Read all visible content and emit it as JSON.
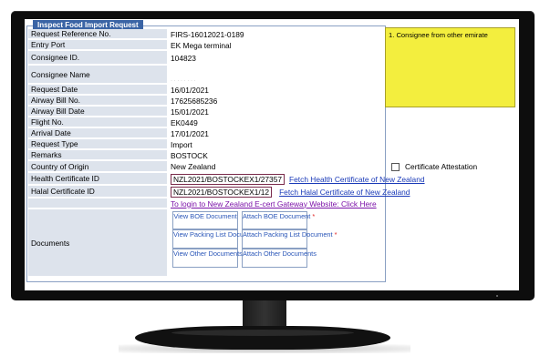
{
  "form": {
    "legend": "Inspect Food Import Request",
    "rows": [
      {
        "label": "Request Reference No.",
        "value": "FIRS-16012021-0189"
      },
      {
        "label": "Entry Port",
        "value": "EK Mega terminal"
      },
      {
        "label": "Consignee ID.",
        "value": "104823"
      },
      {
        "label": "Consignee Name",
        "value": "· · · · · · · ·"
      },
      {
        "label": "Request Date",
        "value": "16/01/2021"
      },
      {
        "label": "Airway Bill No.",
        "value": "17625685236"
      },
      {
        "label": "Airway Bill Date",
        "value": "15/01/2021"
      },
      {
        "label": "Flight No.",
        "value": "EK0449"
      },
      {
        "label": "Arrival Date",
        "value": "17/01/2021"
      },
      {
        "label": "Request Type",
        "value": "Import"
      },
      {
        "label": "Remarks",
        "value": "BOSTOCK"
      },
      {
        "label": "Country of Origin",
        "value": "New Zealand"
      }
    ],
    "certificate_attestation_label": "Certificate Attestation",
    "health_certificate": {
      "label": "Health Certificate ID",
      "value": "NZL2021/BOSTOCKEX1/27357",
      "link": "Fetch Health Certificate of New Zealand"
    },
    "halal_certificate": {
      "label": "Halal Certificate ID",
      "value": "NZL2021/BOSTOCKEX1/12",
      "link": "Fetch Halal Certificate of New Zealand"
    },
    "ecert_link": "To login to New Zealand E-cert Gateway Website: Click Here",
    "documents": {
      "label": "Documents",
      "view_boe": "View BOE Document",
      "attach_boe": "Attach BOE Document",
      "view_packing": "View Packing List Documents",
      "attach_packing": "Attach Packing List Document",
      "view_other": "View Other Documents",
      "attach_other": "Attach Other Documents",
      "required_mark": "*"
    }
  },
  "note": {
    "text": "1. Consignee from other emirate"
  },
  "colors": {
    "label_bg": "#dde3ec",
    "legend_bg": "#3a64a5",
    "link_blue": "#1a3ab8",
    "link_purple": "#7b11a8",
    "note_bg": "#f3ee3e",
    "required": "#e02020"
  }
}
